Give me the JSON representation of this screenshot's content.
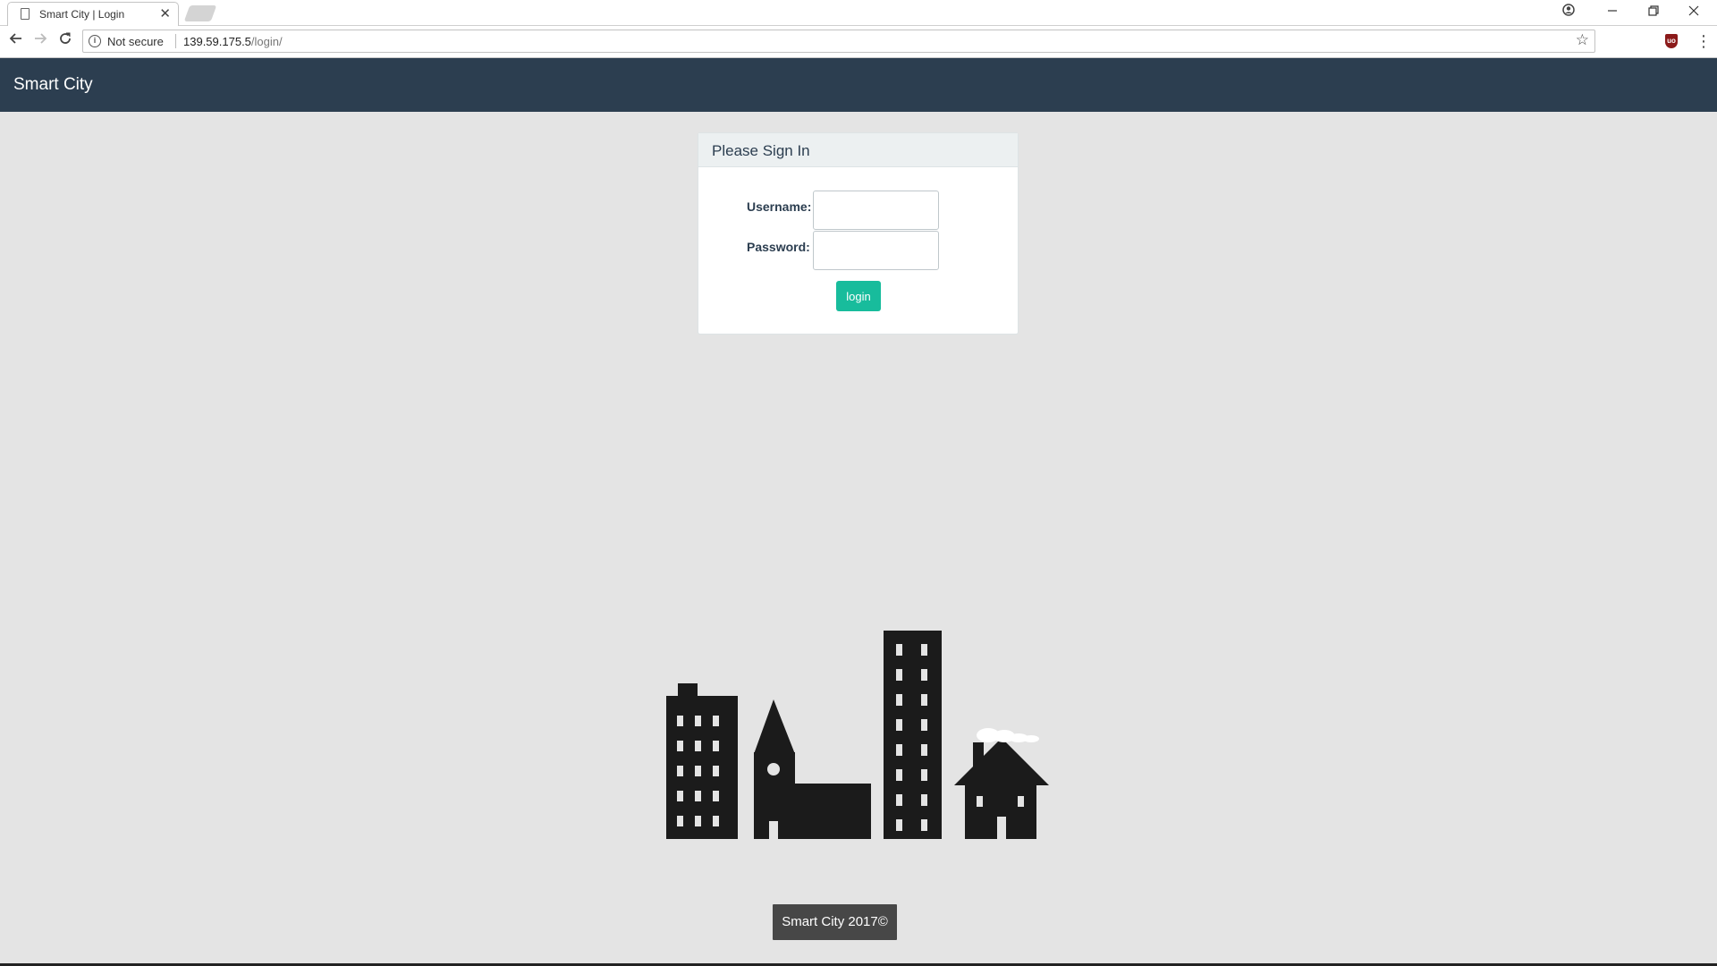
{
  "browser": {
    "tab_title": "Smart City | Login",
    "tab_close": "✕",
    "security_label": "Not secure",
    "url_host": "139.59.175.5",
    "url_path": "/login/",
    "ext_label": "uo"
  },
  "navbar": {
    "brand": "Smart City"
  },
  "login_panel": {
    "heading": "Please Sign In",
    "username_label": "Username:",
    "username_value": "",
    "password_label": "Password:",
    "password_value": "",
    "submit_label": "login"
  },
  "footer": {
    "text": "Smart City 2017©"
  },
  "colors": {
    "navbar_bg": "#2c3e50",
    "page_bg": "#e4e4e4",
    "button_bg": "#18bc9c",
    "footer_bg": "#474747",
    "city_silhouette": "#1b1b1b"
  },
  "icons": {
    "back": "arrow-left-icon",
    "forward": "arrow-right-icon",
    "reload": "reload-icon",
    "info": "info-icon",
    "bookmark": "star-icon",
    "profile": "account-icon",
    "illustration": "city-skyline-icon"
  }
}
